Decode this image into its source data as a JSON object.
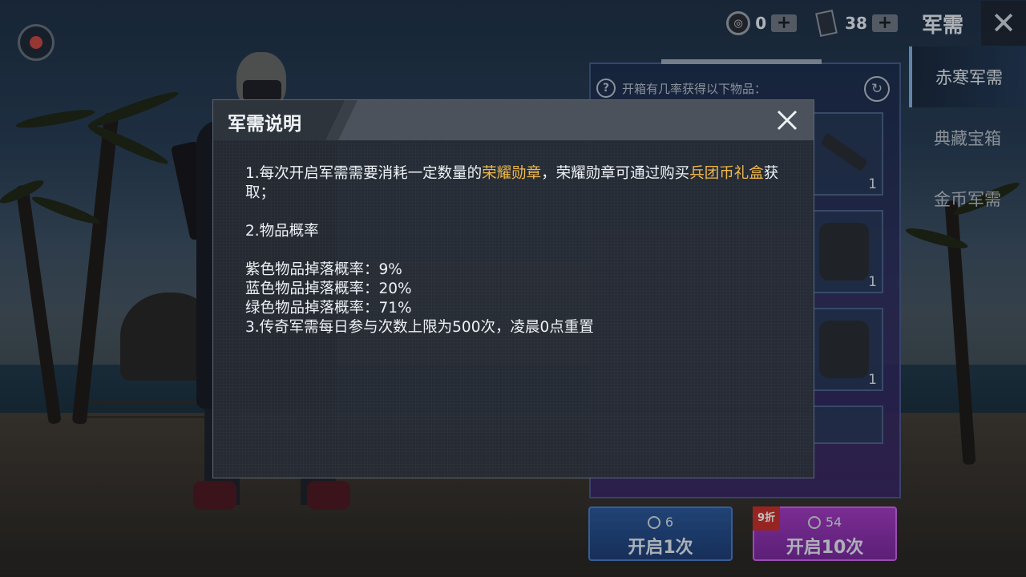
{
  "topbar": {
    "currency1_value": "0",
    "currency1_glyph": "◎",
    "currency2_value": "38",
    "plus_label": "+",
    "title": "军需",
    "close_glyph": "✕"
  },
  "side_tabs": [
    {
      "label": "赤寒军需",
      "active": true
    },
    {
      "label": "典藏宝箱",
      "active": false
    },
    {
      "label": "金币军需",
      "active": false
    }
  ],
  "item_panel": {
    "help_glyph": "?",
    "header_text": "开箱有几率获得以下物品：",
    "refresh_glyph": "↻",
    "items": [
      {
        "qty": "1"
      },
      {
        "qty": "1"
      },
      {
        "qty": "1"
      }
    ],
    "open_once": {
      "cost": "6",
      "label": "开启1次"
    },
    "open_ten": {
      "cost": "54",
      "label": "开启10次",
      "discount": "9折"
    }
  },
  "modal": {
    "title": "军需说明",
    "rule1": {
      "prefix": "1.每次开启军需需要消耗一定数量的",
      "highlight1": "荣耀勋章",
      "middle": "，荣耀勋章可通过购买",
      "highlight2": "兵团币礼盒",
      "suffix": "获取；"
    },
    "rule2_title": "2.物品概率",
    "rates": [
      "紫色物品掉落概率：9%",
      "蓝色物品掉落概率：20%",
      "绿色物品掉落概率：71%"
    ],
    "rule3": "3.传奇军需每日参与次数上限为500次，凌晨0点重置"
  },
  "colors": {
    "highlight": "#f0b84a",
    "modal_bg": "#262c34",
    "blue_button": "#2b5a9c",
    "purple_button": "#a43cc4"
  }
}
